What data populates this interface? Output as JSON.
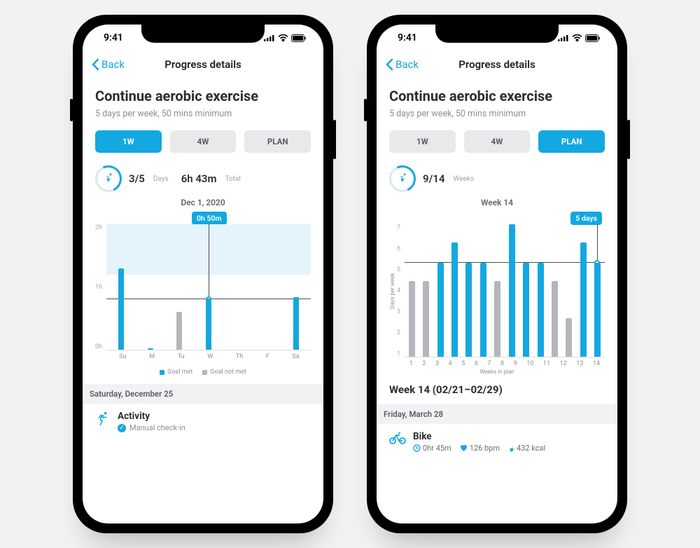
{
  "statusbar": {
    "time": "9:41"
  },
  "nav": {
    "back": "Back",
    "title": "Progress details"
  },
  "header": {
    "title": "Continue aerobic exercise",
    "subtitle": "5 days per week, 50 mins minimum"
  },
  "tabs": {
    "t0": "1W",
    "t1": "4W",
    "t2": "PLAN"
  },
  "left": {
    "stat_days": "3/5",
    "stat_days_label": "Days",
    "stat_total": "6h 43m",
    "stat_total_label": "Total",
    "chart_caption": "Dec 1, 2020",
    "tooltip": "0h 50m",
    "section_date": "Saturday, December 25",
    "activity_title": "Activity",
    "activity_sub": "Manual check-in",
    "legend": {
      "met": "Goal met",
      "notmet": "Goal not met"
    }
  },
  "right": {
    "stat_weeks": "9/14",
    "stat_weeks_label": "Weeks",
    "chart_caption": "Week 14",
    "tooltip": "5 days",
    "week_title": "Week 14 (02/21–02/29)",
    "section_date": "Friday, March 28",
    "activity_title": "Bike",
    "m_time": "0hr 45m",
    "m_bpm": "126 bpm",
    "m_kcal": "432 kcal"
  },
  "chart_data": [
    {
      "type": "bar",
      "title": "Dec 1, 2020",
      "ylabel": "",
      "xlabel": "",
      "yticks": [
        "2h",
        "1h",
        "0h"
      ],
      "ylim": [
        0,
        2
      ],
      "goal": 0.83,
      "selected_index": 3,
      "tooltip": "0h 50m",
      "categories": [
        "Su",
        "M",
        "Tu",
        "W",
        "Th",
        "F",
        "Sa"
      ],
      "series": [
        {
          "name": "Goal met",
          "color": "#13A8E0",
          "values": [
            1.3,
            0,
            null,
            0.83,
            null,
            null,
            0.85
          ]
        },
        {
          "name": "Goal not met",
          "color": "#b4b6bb",
          "values": [
            null,
            null,
            0.6,
            null,
            null,
            null,
            null
          ]
        }
      ]
    },
    {
      "type": "bar",
      "title": "Week 14",
      "ylabel": "Days per week",
      "xlabel": "Weeks in plan",
      "yticks": [
        "7",
        "6",
        "5",
        "4",
        "3",
        "2",
        "1"
      ],
      "ylim": [
        0,
        7
      ],
      "goal": 5,
      "selected_index": 13,
      "tooltip": "5 days",
      "categories": [
        "1",
        "2",
        "3",
        "4",
        "5",
        "6",
        "7",
        "8",
        "9",
        "10",
        "11",
        "12",
        "13",
        "14"
      ],
      "series": [
        {
          "name": "Goal met",
          "color": "#13A8E0",
          "values": [
            null,
            null,
            5,
            6,
            5,
            5,
            null,
            7,
            5,
            5,
            null,
            null,
            6,
            5
          ]
        },
        {
          "name": "Goal not met",
          "color": "#b4b6bb",
          "values": [
            4,
            4,
            null,
            null,
            null,
            null,
            4,
            null,
            null,
            null,
            4,
            2,
            null,
            null
          ]
        }
      ]
    }
  ]
}
